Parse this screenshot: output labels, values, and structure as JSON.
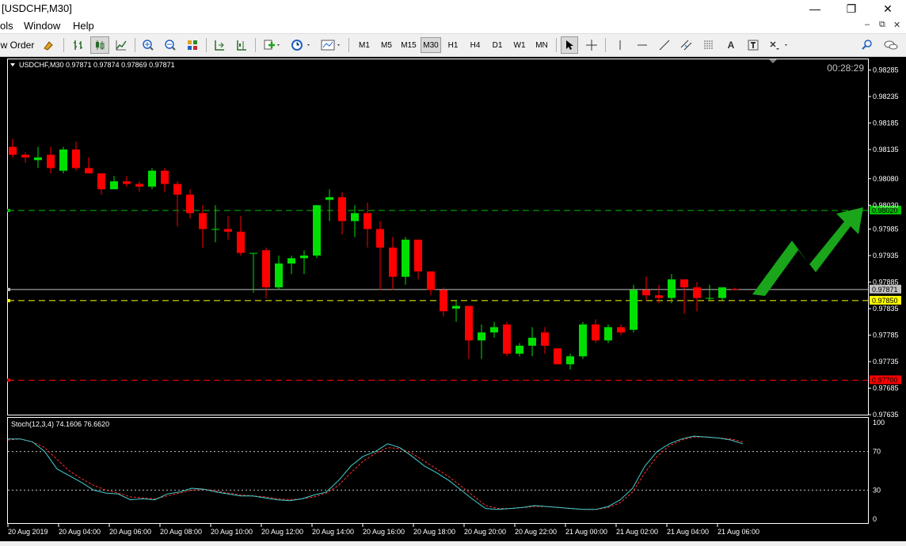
{
  "window": {
    "title": "[USDCHF,M30]",
    "minimize": "—",
    "restore": "❐",
    "close": "✕"
  },
  "menu": {
    "items": [
      "ols",
      "Window",
      "Help"
    ],
    "mdi_controls": [
      "–",
      "⧉",
      "✕"
    ]
  },
  "toolbar": {
    "new_order_label": "w Order",
    "timeframes": [
      "M1",
      "M5",
      "M15",
      "M30",
      "H1",
      "H4",
      "D1",
      "W1",
      "MN"
    ],
    "active_timeframe": "M30"
  },
  "chart": {
    "header": "USDCHF,M30  0.97871 0.97874 0.97869 0.97871",
    "countdown": "00:28:29",
    "indicator_header": "Stoch(12,3,4) 74.1606 76.6620",
    "colors": {
      "background": "#000000",
      "bull": "#00e000",
      "bear": "#ff0000",
      "grid": "#ffffff",
      "axis_text": "#ffffff"
    }
  },
  "chart_data": {
    "type": "candlestick",
    "symbol": "USDCHF",
    "timeframe": "M30",
    "ylim": [
      0.97635,
      0.98305
    ],
    "price_ticks": [
      "0.98285",
      "0.98235",
      "0.98185",
      "0.98135",
      "0.98080",
      "0.98030",
      "0.97985",
      "0.97935",
      "0.97885",
      "0.97835",
      "0.97785",
      "0.97735",
      "0.97685",
      "0.97635"
    ],
    "time_labels": [
      "20 Aug 2019",
      "20 Aug 04:00",
      "20 Aug 06:00",
      "20 Aug 08:00",
      "20 Aug 10:00",
      "20 Aug 12:00",
      "20 Aug 14:00",
      "20 Aug 16:00",
      "20 Aug 18:00",
      "20 Aug 20:00",
      "20 Aug 22:00",
      "21 Aug 00:00",
      "21 Aug 02:00",
      "21 Aug 04:00",
      "21 Aug 06:00"
    ],
    "horizontal_lines": [
      {
        "price": 0.9802,
        "label": "0.98020",
        "color": "#00c000"
      },
      {
        "price": 0.97871,
        "label": "0.97871",
        "color": "#c0c0c0"
      },
      {
        "price": 0.9785,
        "label": "0.97850",
        "color": "#ffff00"
      },
      {
        "price": 0.977,
        "label": "0.97700",
        "color": "#ff0000"
      }
    ],
    "candles": [
      {
        "o": 0.9814,
        "h": 0.98155,
        "l": 0.9812,
        "c": 0.98125
      },
      {
        "o": 0.98125,
        "h": 0.9813,
        "l": 0.9811,
        "c": 0.9812
      },
      {
        "o": 0.98115,
        "h": 0.9814,
        "l": 0.981,
        "c": 0.9812
      },
      {
        "o": 0.98125,
        "h": 0.9814,
        "l": 0.9809,
        "c": 0.981
      },
      {
        "o": 0.98095,
        "h": 0.9814,
        "l": 0.9809,
        "c": 0.98135
      },
      {
        "o": 0.98135,
        "h": 0.9815,
        "l": 0.98095,
        "c": 0.981
      },
      {
        "o": 0.981,
        "h": 0.9812,
        "l": 0.9809,
        "c": 0.9809
      },
      {
        "o": 0.9809,
        "h": 0.9809,
        "l": 0.9805,
        "c": 0.9806
      },
      {
        "o": 0.9806,
        "h": 0.98085,
        "l": 0.9806,
        "c": 0.98075
      },
      {
        "o": 0.98075,
        "h": 0.98085,
        "l": 0.98065,
        "c": 0.9807
      },
      {
        "o": 0.9807,
        "h": 0.98075,
        "l": 0.98055,
        "c": 0.98065
      },
      {
        "o": 0.98065,
        "h": 0.981,
        "l": 0.9806,
        "c": 0.98095
      },
      {
        "o": 0.98095,
        "h": 0.981,
        "l": 0.98055,
        "c": 0.9807
      },
      {
        "o": 0.9807,
        "h": 0.98075,
        "l": 0.9799,
        "c": 0.9805
      },
      {
        "o": 0.9805,
        "h": 0.9806,
        "l": 0.98005,
        "c": 0.98015
      },
      {
        "o": 0.98015,
        "h": 0.9803,
        "l": 0.9795,
        "c": 0.97985
      },
      {
        "o": 0.97985,
        "h": 0.9803,
        "l": 0.9796,
        "c": 0.97985
      },
      {
        "o": 0.97985,
        "h": 0.9801,
        "l": 0.97965,
        "c": 0.9798
      },
      {
        "o": 0.9798,
        "h": 0.9801,
        "l": 0.97935,
        "c": 0.9794
      },
      {
        "o": 0.9794,
        "h": 0.9794,
        "l": 0.97865,
        "c": 0.9794
      },
      {
        "o": 0.97945,
        "h": 0.9795,
        "l": 0.97855,
        "c": 0.97875
      },
      {
        "o": 0.97875,
        "h": 0.97935,
        "l": 0.9787,
        "c": 0.9792
      },
      {
        "o": 0.9792,
        "h": 0.97935,
        "l": 0.979,
        "c": 0.9793
      },
      {
        "o": 0.9793,
        "h": 0.97945,
        "l": 0.979,
        "c": 0.97935
      },
      {
        "o": 0.97935,
        "h": 0.9803,
        "l": 0.9793,
        "c": 0.9803
      },
      {
        "o": 0.9804,
        "h": 0.9806,
        "l": 0.98,
        "c": 0.98045
      },
      {
        "o": 0.98045,
        "h": 0.98055,
        "l": 0.97975,
        "c": 0.98
      },
      {
        "o": 0.98,
        "h": 0.9803,
        "l": 0.9797,
        "c": 0.98015
      },
      {
        "o": 0.98015,
        "h": 0.98035,
        "l": 0.9795,
        "c": 0.97985
      },
      {
        "o": 0.97985,
        "h": 0.98,
        "l": 0.9787,
        "c": 0.9795
      },
      {
        "o": 0.9795,
        "h": 0.9797,
        "l": 0.9787,
        "c": 0.97895
      },
      {
        "o": 0.97895,
        "h": 0.9797,
        "l": 0.9788,
        "c": 0.97965
      },
      {
        "o": 0.97965,
        "h": 0.97965,
        "l": 0.9789,
        "c": 0.97905
      },
      {
        "o": 0.97905,
        "h": 0.97905,
        "l": 0.9786,
        "c": 0.9787
      },
      {
        "o": 0.9787,
        "h": 0.97875,
        "l": 0.9782,
        "c": 0.9783
      },
      {
        "o": 0.97835,
        "h": 0.9785,
        "l": 0.9781,
        "c": 0.9784
      },
      {
        "o": 0.9784,
        "h": 0.9784,
        "l": 0.9774,
        "c": 0.97775
      },
      {
        "o": 0.97775,
        "h": 0.97805,
        "l": 0.9774,
        "c": 0.9779
      },
      {
        "o": 0.9779,
        "h": 0.9781,
        "l": 0.9778,
        "c": 0.978
      },
      {
        "o": 0.97805,
        "h": 0.9781,
        "l": 0.97745,
        "c": 0.9775
      },
      {
        "o": 0.9775,
        "h": 0.9777,
        "l": 0.97745,
        "c": 0.97765
      },
      {
        "o": 0.97765,
        "h": 0.978,
        "l": 0.97745,
        "c": 0.9778
      },
      {
        "o": 0.9779,
        "h": 0.978,
        "l": 0.9775,
        "c": 0.97765
      },
      {
        "o": 0.9776,
        "h": 0.9776,
        "l": 0.9773,
        "c": 0.9773
      },
      {
        "o": 0.9773,
        "h": 0.9775,
        "l": 0.9772,
        "c": 0.97745
      },
      {
        "o": 0.97745,
        "h": 0.9781,
        "l": 0.9774,
        "c": 0.97805
      },
      {
        "o": 0.97805,
        "h": 0.97815,
        "l": 0.9777,
        "c": 0.97775
      },
      {
        "o": 0.97775,
        "h": 0.97805,
        "l": 0.9777,
        "c": 0.978
      },
      {
        "o": 0.978,
        "h": 0.97805,
        "l": 0.97785,
        "c": 0.9779
      },
      {
        "o": 0.97795,
        "h": 0.9788,
        "l": 0.9779,
        "c": 0.9787
      },
      {
        "o": 0.9787,
        "h": 0.97895,
        "l": 0.9785,
        "c": 0.9786
      },
      {
        "o": 0.9786,
        "h": 0.9788,
        "l": 0.97845,
        "c": 0.97855
      },
      {
        "o": 0.97855,
        "h": 0.979,
        "l": 0.97845,
        "c": 0.9789
      },
      {
        "o": 0.9789,
        "h": 0.9789,
        "l": 0.97825,
        "c": 0.97875
      },
      {
        "o": 0.97875,
        "h": 0.97885,
        "l": 0.9783,
        "c": 0.97855
      },
      {
        "o": 0.97855,
        "h": 0.9788,
        "l": 0.9785,
        "c": 0.97855
      },
      {
        "o": 0.97855,
        "h": 0.97875,
        "l": 0.9785,
        "c": 0.97875
      },
      {
        "o": 0.97872,
        "h": 0.97874,
        "l": 0.97869,
        "c": 0.97871
      }
    ],
    "stochastic": {
      "name": "Stoch(12,3,4)",
      "ylim": [
        0,
        100
      ],
      "levels": [
        70,
        30
      ],
      "axis_labels": [
        "100",
        "70",
        "30",
        "0"
      ],
      "main": [
        83,
        83,
        80,
        70,
        52,
        45,
        38,
        30,
        27,
        26,
        20,
        21,
        20,
        26,
        28,
        32,
        31,
        28,
        26,
        24,
        24,
        22,
        20,
        19,
        21,
        25,
        28,
        40,
        55,
        65,
        70,
        78,
        74,
        65,
        55,
        48,
        40,
        30,
        20,
        11,
        10,
        11,
        12,
        14,
        13,
        12,
        11,
        10,
        10,
        13,
        20,
        32,
        55,
        70,
        78,
        83,
        86,
        85,
        84,
        82,
        78
      ],
      "signal": [
        82,
        83,
        80,
        74,
        62,
        50,
        42,
        35,
        30,
        27,
        23,
        22,
        21,
        24,
        27,
        30,
        31,
        29,
        27,
        25,
        24,
        23,
        21,
        20,
        21,
        23,
        27,
        35,
        48,
        60,
        68,
        74,
        73,
        68,
        60,
        52,
        44,
        34,
        24,
        14,
        11,
        11,
        12,
        13,
        13,
        12,
        11,
        10,
        10,
        12,
        17,
        28,
        48,
        65,
        76,
        82,
        85,
        85,
        84,
        83,
        80
      ]
    }
  }
}
